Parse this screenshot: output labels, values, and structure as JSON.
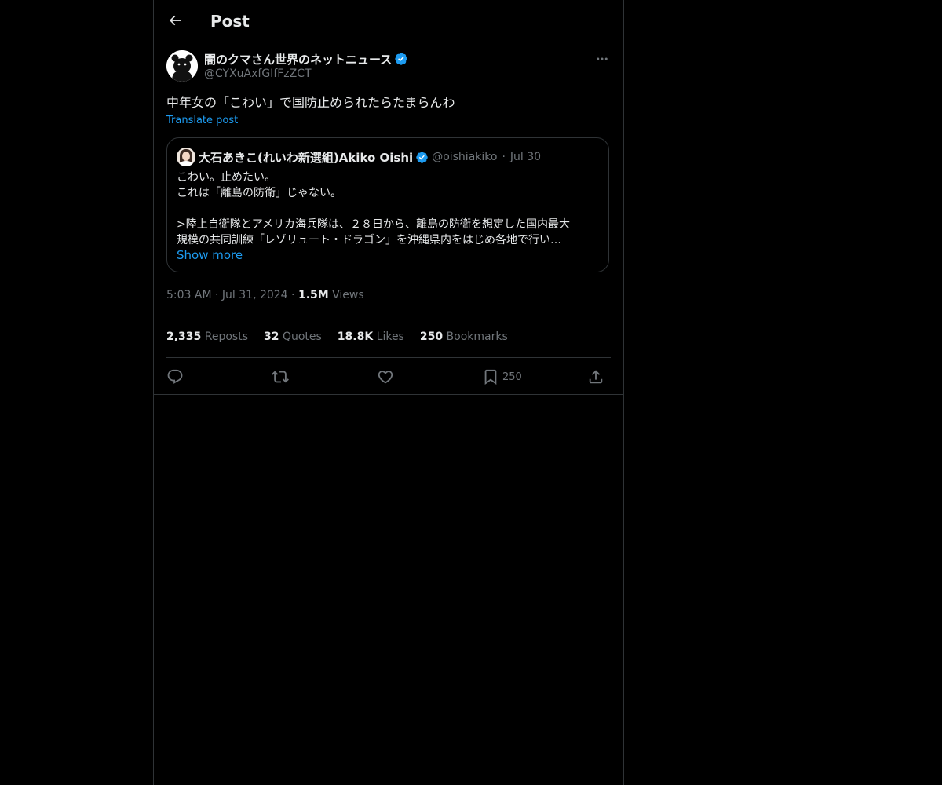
{
  "header": {
    "title": "Post",
    "back_icon": "arrow-left-icon"
  },
  "post": {
    "author_name": "闇のクマさん世界のネットニュース",
    "author_handle": "@CYXuAxfGIfFzZCT",
    "verified": true,
    "text": "中年女の「こわい」で国防止められたらたまらんわ",
    "translate_label": "Translate post",
    "time": "5:03 AM",
    "date": "Jul 31, 2024",
    "views_count": "1.5M",
    "views_label": "Views"
  },
  "quote": {
    "author_name": "大石あきこ(れいわ新選組)Akiko Oishi",
    "author_handle": "@oishiakiko",
    "date": "Jul 30",
    "lines": [
      "こわい。止めたい。",
      "これは「離島の防衛」じゃない。",
      "",
      ">陸上自衛隊とアメリカ海兵隊は、２８日から、離島の防衛を想定した国内最大",
      "規模の共同訓練「レゾリュート・ドラゴン」を沖縄県内をはじめ各地で行い…"
    ],
    "show_more": "Show more"
  },
  "stats": {
    "reposts_count": "2,335",
    "reposts_label": "Reposts",
    "quotes_count": "32",
    "quotes_label": "Quotes",
    "likes_count": "18.8K",
    "likes_label": "Likes",
    "bookmarks_count": "250",
    "bookmarks_label": "Bookmarks"
  },
  "actions": {
    "bookmark_count": "250"
  },
  "colors": {
    "background": "#000000",
    "text": "#e7e9ea",
    "secondary": "#71767b",
    "accent": "#1d9bf0",
    "border": "#2f3336"
  }
}
